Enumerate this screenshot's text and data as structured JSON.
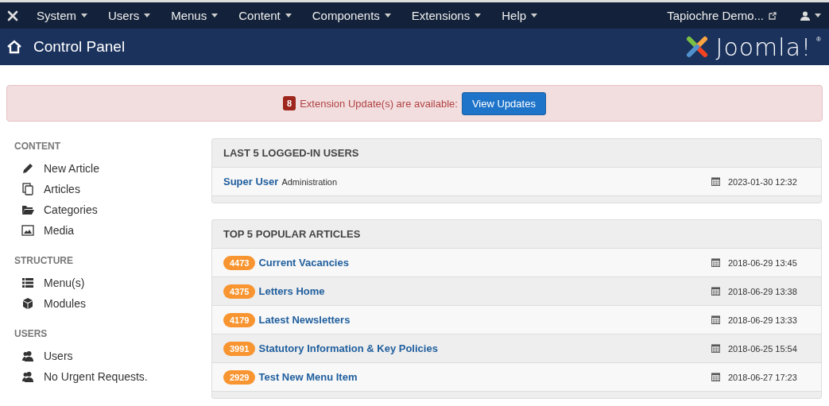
{
  "navbar": {
    "menus": [
      "System",
      "Users",
      "Menus",
      "Content",
      "Components",
      "Extensions",
      "Help"
    ],
    "site_link": "Tapiochre Demo..."
  },
  "header": {
    "title": "Control Panel",
    "logo_text": "Joomla!",
    "logo_mark": "®"
  },
  "alert": {
    "count": "8",
    "message": "Extension Update(s) are available:",
    "button": "View Updates"
  },
  "sidebar": [
    {
      "heading": "CONTENT",
      "items": [
        {
          "kind": "pencil",
          "label": "New Article"
        },
        {
          "kind": "copies",
          "label": "Articles"
        },
        {
          "kind": "folder",
          "label": "Categories"
        },
        {
          "kind": "image",
          "label": "Media"
        }
      ]
    },
    {
      "heading": "STRUCTURE",
      "items": [
        {
          "kind": "list",
          "label": "Menu(s)"
        },
        {
          "kind": "cube",
          "label": "Modules"
        }
      ]
    },
    {
      "heading": "USERS",
      "items": [
        {
          "kind": "users",
          "label": "Users"
        },
        {
          "kind": "users",
          "label": "No Urgent Requests."
        }
      ]
    }
  ],
  "logged_in": {
    "title": "LAST 5 LOGGED-IN USERS",
    "rows": [
      {
        "name": "Super User",
        "role": "Administration",
        "date": "2023-01-30 12:32"
      }
    ]
  },
  "popular": {
    "title": "TOP 5 POPULAR ARTICLES",
    "rows": [
      {
        "hits": "4473",
        "title": "Current Vacancies",
        "date": "2018-06-29 13:45"
      },
      {
        "hits": "4375",
        "title": "Letters Home",
        "date": "2018-06-29 13:38"
      },
      {
        "hits": "4179",
        "title": "Latest Newsletters",
        "date": "2018-06-29 13:33"
      },
      {
        "hits": "3991",
        "title": "Statutory Information & Key Policies",
        "date": "2018-06-25 15:54"
      },
      {
        "hits": "2929",
        "title": "Test New Menu Item",
        "date": "2018-06-27 17:23"
      }
    ]
  }
}
